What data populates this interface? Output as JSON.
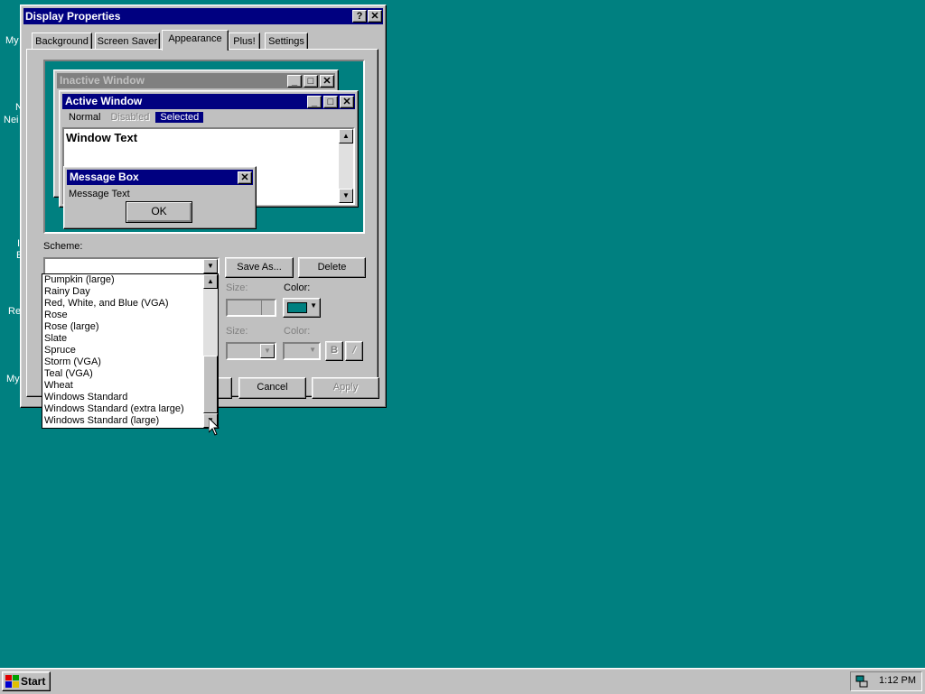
{
  "desktop": {
    "icon_fragments": [
      "My",
      "N",
      "Nei",
      "I",
      "E",
      "Re",
      "My"
    ]
  },
  "dialog": {
    "title": "Display Properties",
    "help_btn": "?",
    "close_btn": "✕",
    "tabs": [
      "Background",
      "Screen Saver",
      "Appearance",
      "Plus!",
      "Settings"
    ],
    "active_tab": "Appearance"
  },
  "preview": {
    "inactive_title": "Inactive Window",
    "active_title": "Active Window",
    "menu": {
      "normal": "Normal",
      "disabled": "Disabled",
      "selected": "Selected"
    },
    "window_text": "Window Text",
    "msgbox_title": "Message Box",
    "msgbox_text": "Message Text",
    "ok": "OK"
  },
  "scheme": {
    "label": "Scheme:",
    "value": "",
    "save_as": "Save As...",
    "delete": "Delete",
    "options": [
      "Pumpkin (large)",
      "Rainy Day",
      "Red, White, and Blue (VGA)",
      "Rose",
      "Rose (large)",
      "Slate",
      "Spruce",
      "Storm (VGA)",
      "Teal (VGA)",
      "Wheat",
      "Windows Standard",
      "Windows Standard (extra large)",
      "Windows Standard (large)"
    ]
  },
  "item": {
    "size_label": "Size:",
    "color_label": "Color:",
    "font_size_label": "Size:",
    "font_color_label": "Color:",
    "bold": "B",
    "italic": "/",
    "color_swatch": "#008080"
  },
  "buttons": {
    "cancel": "Cancel",
    "apply": "Apply"
  },
  "taskbar": {
    "start": "Start",
    "time": "1:12 PM"
  }
}
